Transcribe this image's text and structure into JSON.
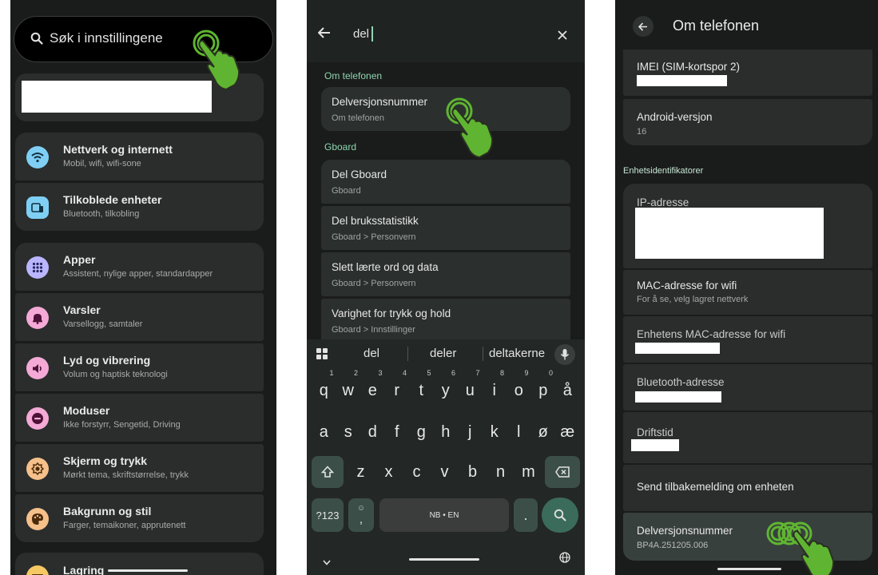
{
  "screen1": {
    "search_placeholder": "Søk i innstillingene",
    "items": [
      {
        "title": "Nettverk og internett",
        "subtitle": "Mobil, wifi, wifi-sone",
        "icon": "wifi-icon",
        "color": "#7fcff5"
      },
      {
        "title": "Tilkoblede enheter",
        "subtitle": "Bluetooth, tilkobling",
        "icon": "devices-icon",
        "color": "#7fcff5"
      },
      {
        "title": "Apper",
        "subtitle": "Assistent, nylige apper, standardapper",
        "icon": "apps-grid-icon",
        "color": "#b9b6ff"
      },
      {
        "title": "Varsler",
        "subtitle": "Varsellogg, samtaler",
        "icon": "bell-icon",
        "color": "#f4a9d6"
      },
      {
        "title": "Lyd og vibrering",
        "subtitle": "Volum og haptisk teknologi",
        "icon": "volume-icon",
        "color": "#f4a9d6"
      },
      {
        "title": "Moduser",
        "subtitle": "Ikke forstyrr, Sengetid, Driving",
        "icon": "minus-circle-icon",
        "color": "#f4a9d6"
      },
      {
        "title": "Skjerm og trykk",
        "subtitle": "Mørkt tema, skriftstørrelse, trykk",
        "icon": "brightness-icon",
        "color": "#f6c08a"
      },
      {
        "title": "Bakgrunn og stil",
        "subtitle": "Farger, temaikoner, apprutenett",
        "icon": "palette-icon",
        "color": "#f6c08a"
      },
      {
        "title": "Lagring",
        "subtitle": "",
        "icon": "storage-icon",
        "color": "#f6c863"
      }
    ]
  },
  "screen2": {
    "query": "del",
    "sections": [
      {
        "label": "Om telefonen",
        "results": [
          {
            "title": "Delversjonsnummer",
            "subtitle": "Om telefonen"
          }
        ]
      },
      {
        "label": "Gboard",
        "results": [
          {
            "title": "Del Gboard",
            "subtitle": "Gboard"
          },
          {
            "title": "Del bruksstatistikk",
            "subtitle": "Gboard > Personvern"
          },
          {
            "title": "Slett lærte ord og data",
            "subtitle": "Gboard > Personvern"
          },
          {
            "title": "Varighet for trykk og hold",
            "subtitle": "Gboard > Innstillinger"
          }
        ]
      }
    ],
    "suggestions": [
      "del",
      "deler",
      "deltakerne"
    ],
    "row1": [
      "q",
      "w",
      "e",
      "r",
      "t",
      "y",
      "u",
      "i",
      "o",
      "p",
      "å"
    ],
    "row1_nums": [
      "1",
      "2",
      "3",
      "4",
      "5",
      "6",
      "7",
      "8",
      "9",
      "0",
      ""
    ],
    "row2": [
      "a",
      "s",
      "d",
      "f",
      "g",
      "h",
      "j",
      "k",
      "l",
      "ø",
      "æ"
    ],
    "row3": [
      "z",
      "x",
      "c",
      "v",
      "b",
      "n",
      "m"
    ],
    "key_123": "?123",
    "key_emoji_sub": ",",
    "space_label": "NB • EN",
    "period_key": "."
  },
  "screen3": {
    "title": "Om telefonen",
    "imei_label": "IMEI (SIM-kortspor 2)",
    "android_label": "Android-versjon",
    "android_value": "16",
    "section_label": "Enhetsidentifikatorer",
    "ip_label": "IP-adresse",
    "mac_label": "MAC-adresse for wifi",
    "mac_sub": "For å se, velg lagret nettverk",
    "device_mac_label": "Enhetens MAC-adresse for wifi",
    "bt_label": "Bluetooth-adresse",
    "uptime_label": "Driftstid",
    "feedback_label": "Send tilbakemelding om enheten",
    "build_label": "Delversjonsnummer",
    "build_value": "BP4A.251205.006"
  },
  "colors": {
    "accent_green": "#5fb531",
    "section_green": "#8fd6b2"
  }
}
